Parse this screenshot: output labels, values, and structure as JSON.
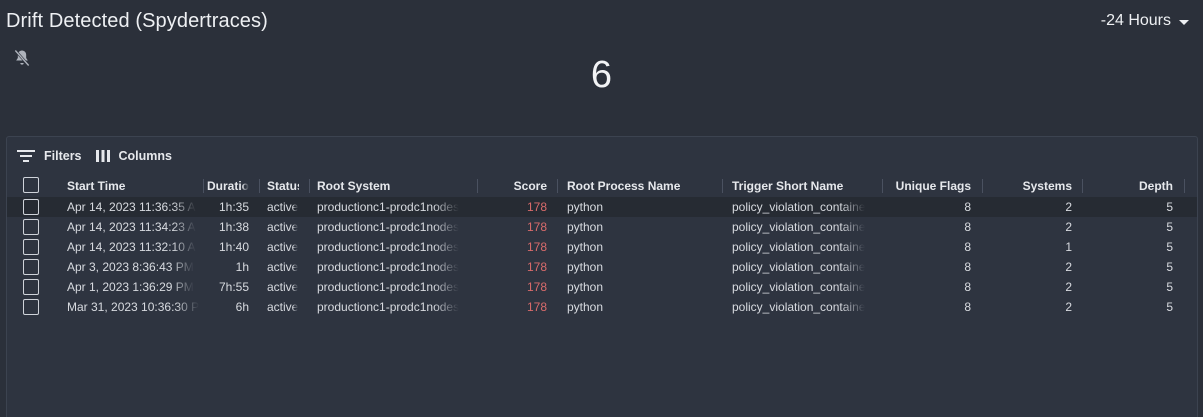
{
  "widget": {
    "title": "Drift Detected (Spydertraces)",
    "time_range": "-24 Hours",
    "count": "6",
    "mute_icon": "bell-off-icon"
  },
  "toolbar": {
    "filters_label": "Filters",
    "columns_label": "Columns",
    "filters_icon": "filter-lines-icon",
    "columns_icon": "columns-icon"
  },
  "table": {
    "columns": [
      "Start Time",
      "Duratio",
      "Status",
      "Root System",
      "Score",
      "Root Process Name",
      "Trigger Short Name",
      "Unique Flags",
      "Systems",
      "Depth"
    ],
    "rows": [
      {
        "start_time": "Apr 14, 2023 11:36:35 A",
        "duration": "1h:35",
        "status": "active",
        "root_system": "productionc1-prodc1nodes",
        "score": "178",
        "root_process": "python",
        "trigger": "policy_violation_containe",
        "unique_flags": "8",
        "systems": "2",
        "depth": "5"
      },
      {
        "start_time": "Apr 14, 2023 11:34:23 A",
        "duration": "1h:38",
        "status": "active",
        "root_system": "productionc1-prodc1nodes",
        "score": "178",
        "root_process": "python",
        "trigger": "policy_violation_containe",
        "unique_flags": "8",
        "systems": "2",
        "depth": "5"
      },
      {
        "start_time": "Apr 14, 2023 11:32:10 A",
        "duration": "1h:40",
        "status": "active",
        "root_system": "productionc1-prodc1nodes",
        "score": "178",
        "root_process": "python",
        "trigger": "policy_violation_containe",
        "unique_flags": "8",
        "systems": "1",
        "depth": "5"
      },
      {
        "start_time": "Apr 3, 2023 8:36:43 PM",
        "duration": "1h",
        "status": "active",
        "root_system": "productionc1-prodc1nodes",
        "score": "178",
        "root_process": "python",
        "trigger": "policy_violation_containe",
        "unique_flags": "8",
        "systems": "2",
        "depth": "5"
      },
      {
        "start_time": "Apr 1, 2023 1:36:29 PM",
        "duration": "7h:55",
        "status": "active",
        "root_system": "productionc1-prodc1nodes",
        "score": "178",
        "root_process": "python",
        "trigger": "policy_violation_containe",
        "unique_flags": "8",
        "systems": "2",
        "depth": "5"
      },
      {
        "start_time": "Mar 31, 2023 10:36:30 P",
        "duration": "6h",
        "status": "active",
        "root_system": "productionc1-prodc1nodes",
        "score": "178",
        "root_process": "python",
        "trigger": "policy_violation_containe",
        "unique_flags": "8",
        "systems": "2",
        "depth": "5"
      }
    ]
  },
  "colors": {
    "background": "#2b303a",
    "panel": "#2e3440",
    "score_text": "#d96b6b",
    "highlight_row": "#262b33"
  }
}
